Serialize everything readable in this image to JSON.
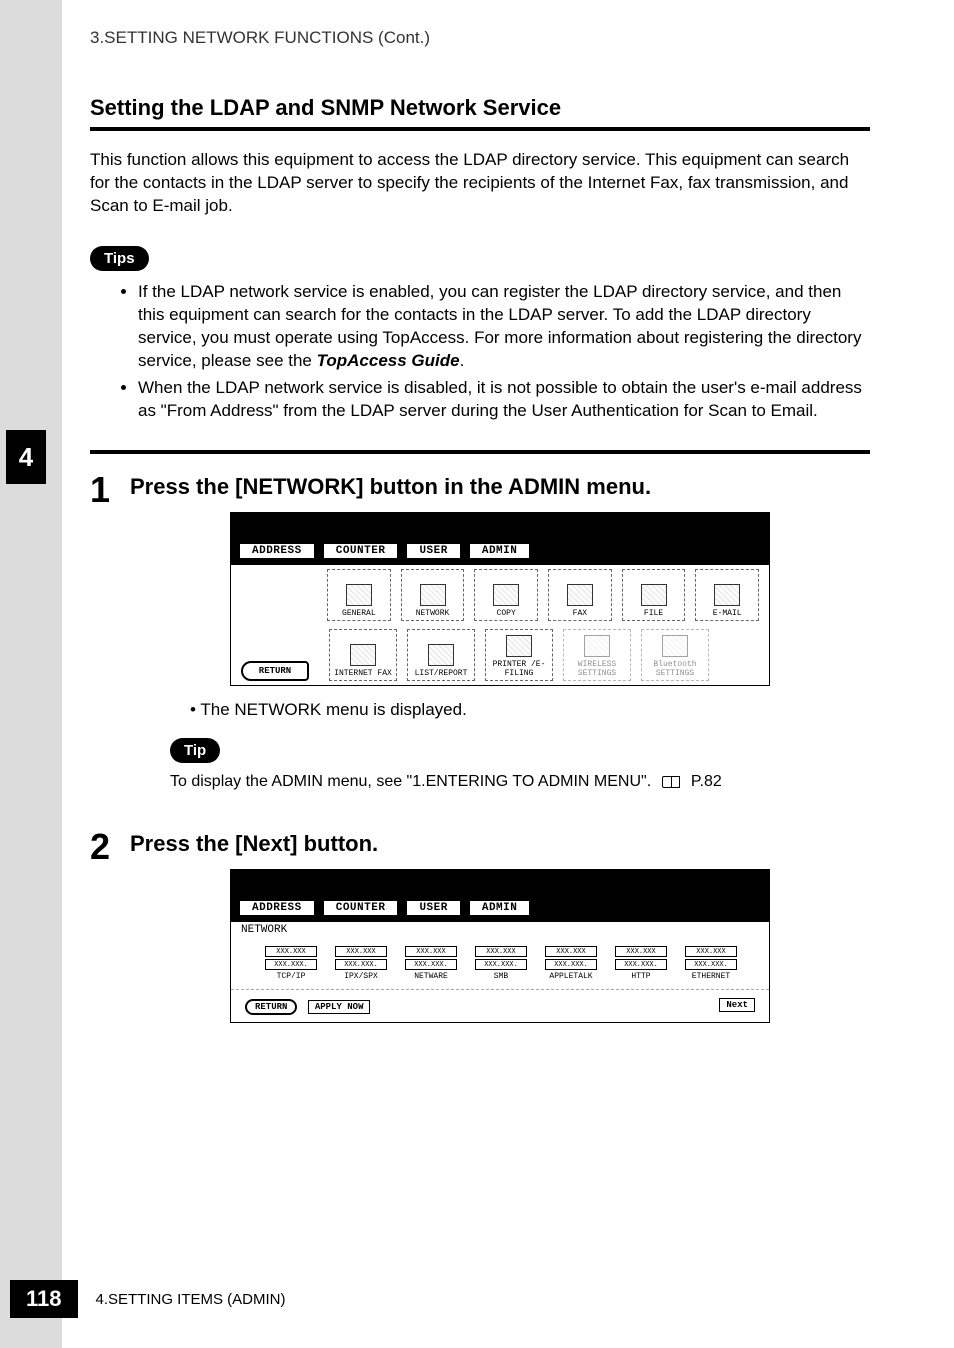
{
  "breadcrumb": "3.SETTING NETWORK FUNCTIONS (Cont.)",
  "section_title": "Setting the LDAP and SNMP Network Service",
  "intro": "This function allows this equipment to access the LDAP directory service.  This equipment can search for the contacts in the LDAP server to specify the recipients of the Internet Fax, fax transmission, and Scan to E-mail job.",
  "tips_label": "Tips",
  "tips": [
    {
      "prefix": "If the LDAP network service is enabled, you can register the LDAP directory service, and then this equipment can search for the contacts in the LDAP server.  To add the LDAP directory service, you must operate using TopAccess.  For more information about registering the directory service, please see the ",
      "emphasis": "TopAccess Guide",
      "suffix": "."
    },
    {
      "prefix": "When the LDAP network service is disabled, it is not possible to obtain the user's e-mail address as \"From Address\" from the LDAP server during the User Authentication for Scan to Email.",
      "emphasis": "",
      "suffix": ""
    }
  ],
  "side_chapter": "4",
  "step1": {
    "num": "1",
    "title": "Press the [NETWORK] button in the ADMIN menu.",
    "tabs": [
      "ADDRESS",
      "COUNTER",
      "USER",
      "ADMIN"
    ],
    "row1": [
      "GENERAL",
      "NETWORK",
      "COPY",
      "FAX",
      "FILE",
      "E-MAIL"
    ],
    "row2": [
      "INTERNET FAX",
      "LIST/REPORT",
      "PRINTER /E-FILING",
      "WIRELESS SETTINGS",
      "Bluetooth SETTINGS"
    ],
    "return": "RETURN",
    "after": "The NETWORK menu is displayed."
  },
  "tip_label": "Tip",
  "tip_ref_prefix": "To display the ADMIN menu, see \"1.ENTERING TO ADMIN MENU\".",
  "tip_ref_page": "P.82",
  "step2": {
    "num": "2",
    "title": "Press the [Next] button.",
    "tabs": [
      "ADDRESS",
      "COUNTER",
      "USER",
      "ADMIN"
    ],
    "subhead": "NETWORK",
    "row1": [
      "TCP/IP",
      "IPX/SPX",
      "NETWARE",
      "SMB",
      "APPLETALK",
      "HTTP",
      "ETHERNET"
    ],
    "placeholder": "XXX.XXX",
    "placeholder2": "XXX.XXX.",
    "return": "RETURN",
    "apply": "APPLY NOW",
    "next": "Next"
  },
  "footer": {
    "page": "118",
    "text": "4.SETTING ITEMS (ADMIN)"
  }
}
